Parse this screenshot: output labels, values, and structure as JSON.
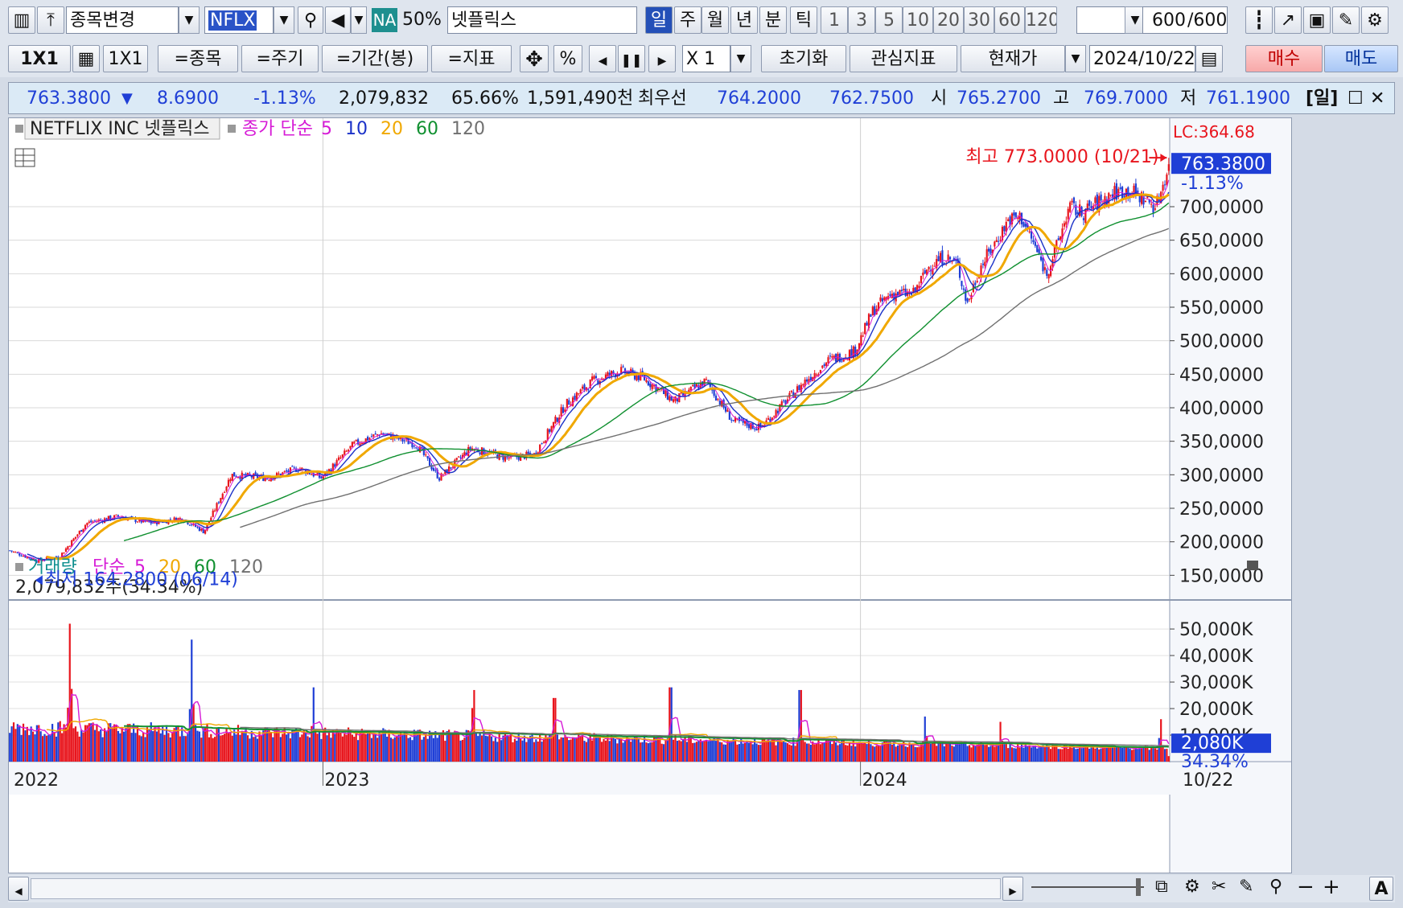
{
  "toolbar1": {
    "stock_change": "종목변경",
    "ticker": "NFLX",
    "na_badge": "NA",
    "percent": "50%",
    "name_kr": "넷플릭스",
    "periods": [
      "일",
      "주",
      "월",
      "년",
      "분",
      "틱"
    ],
    "active_period": "일",
    "nums": [
      "1",
      "3",
      "5",
      "10",
      "20",
      "30",
      "60",
      "120"
    ],
    "count_value": "600",
    "count_total": "/600"
  },
  "toolbar2": {
    "layout": "1X1",
    "layout2": "1X1",
    "stock_btn": "=종목",
    "period_btn": "=주기",
    "range_btn": "=기간(봉)",
    "indicator_btn": "=지표",
    "percent_btn": "%",
    "mult": "X 1",
    "reset": "초기화",
    "fav_indicator": "관심지표",
    "price_type": "현재가",
    "date": "2024/10/22",
    "buy": "매수",
    "sell": "매도"
  },
  "infobar": {
    "price": "763.3800",
    "change": "8.6900",
    "change_pct": "-1.13%",
    "volume": "2,079,832",
    "vol_pct": "65.66%",
    "amount": "1,591,490천",
    "best_label": "최우선",
    "ask": "764.2000",
    "bid": "762.7500",
    "open_label": "시",
    "open": "765.2700",
    "high_label": "고",
    "high": "769.7000",
    "low_label": "저",
    "low": "761.1900",
    "period_tag": "[일]"
  },
  "colors": {
    "up": "#e8151d",
    "down": "#1f3fd6",
    "ma5": "#d61ad6",
    "ma10": "#1a31c8",
    "ma20": "#f0a800",
    "ma60": "#109030",
    "ma120": "#707070",
    "accent": "#0f2fb0"
  },
  "chart_data": [
    {
      "type": "candlestick",
      "title": "NETFLIX INC  넷플릭스",
      "legend": {
        "basis": "종가 단순",
        "periods": [
          "5",
          "10",
          "20",
          "60",
          "120"
        ]
      },
      "x_labels": [
        "2022",
        "2023",
        "2024",
        "10/22"
      ],
      "ylim": [
        130,
        790
      ],
      "y_ticks": [
        "150,0000",
        "200,0000",
        "250,0000",
        "300,0000",
        "350,0000",
        "400,0000",
        "450,0000",
        "500,0000",
        "550,0000",
        "600,0000",
        "650,0000",
        "700,0000"
      ],
      "y_tick_values": [
        150,
        200,
        250,
        300,
        350,
        400,
        450,
        500,
        550,
        600,
        650,
        700
      ],
      "right_label_lc": "LC:364.68",
      "last_price_label": "763.3800",
      "last_change_label": "-1.13%",
      "annotation_high": "최고 773.0000 (10/21)",
      "annotation_low": "최저 164.2800 (06/14)",
      "anchors": [
        {
          "t": 0.0,
          "v": 187
        },
        {
          "t": 0.03,
          "v": 172
        },
        {
          "t": 0.055,
          "v": 178
        },
        {
          "t": 0.085,
          "v": 228
        },
        {
          "t": 0.12,
          "v": 238
        },
        {
          "t": 0.155,
          "v": 228
        },
        {
          "t": 0.19,
          "v": 235
        },
        {
          "t": 0.215,
          "v": 215
        },
        {
          "t": 0.245,
          "v": 300
        },
        {
          "t": 0.285,
          "v": 295
        },
        {
          "t": 0.32,
          "v": 310
        },
        {
          "t": 0.345,
          "v": 295
        },
        {
          "t": 0.38,
          "v": 345
        },
        {
          "t": 0.41,
          "v": 362
        },
        {
          "t": 0.45,
          "v": 345
        },
        {
          "t": 0.475,
          "v": 295
        },
        {
          "t": 0.51,
          "v": 340
        },
        {
          "t": 0.55,
          "v": 325
        },
        {
          "t": 0.58,
          "v": 330
        },
        {
          "t": 0.615,
          "v": 405
        },
        {
          "t": 0.645,
          "v": 440
        },
        {
          "t": 0.675,
          "v": 455
        },
        {
          "t": 0.7,
          "v": 445
        },
        {
          "t": 0.735,
          "v": 410
        },
        {
          "t": 0.77,
          "v": 440
        },
        {
          "t": 0.8,
          "v": 380
        },
        {
          "t": 0.83,
          "v": 370
        },
        {
          "t": 0.855,
          "v": 405
        },
        {
          "t": 0.88,
          "v": 440
        },
        {
          "t": 0.905,
          "v": 470
        },
        {
          "t": 0.935,
          "v": 485
        },
        {
          "t": 0.955,
          "v": 545
        },
        {
          "t": 0.975,
          "v": 570
        }
      ],
      "note": "price anchors span 2022-01 to 2024-05 scaled; continued below",
      "anchors2": [
        {
          "t": 0.0,
          "v": 570
        },
        {
          "t": 0.06,
          "v": 612
        },
        {
          "t": 0.12,
          "v": 625
        },
        {
          "t": 0.17,
          "v": 615
        },
        {
          "t": 0.21,
          "v": 555
        },
        {
          "t": 0.26,
          "v": 610
        },
        {
          "t": 0.31,
          "v": 640
        },
        {
          "t": 0.37,
          "v": 680
        },
        {
          "t": 0.42,
          "v": 685
        },
        {
          "t": 0.47,
          "v": 645
        },
        {
          "t": 0.52,
          "v": 600
        },
        {
          "t": 0.56,
          "v": 640
        },
        {
          "t": 0.61,
          "v": 700
        },
        {
          "t": 0.66,
          "v": 690
        },
        {
          "t": 0.72,
          "v": 705
        },
        {
          "t": 0.78,
          "v": 720
        },
        {
          "t": 0.84,
          "v": 725
        },
        {
          "t": 0.9,
          "v": 712
        },
        {
          "t": 0.95,
          "v": 700
        },
        {
          "t": 1.0,
          "v": 763
        }
      ]
    },
    {
      "type": "bar",
      "title": "거래량",
      "legend": {
        "basis": "단순",
        "periods": [
          "5",
          "20",
          "60",
          "120"
        ]
      },
      "readout": "2,079,832주(34.34%)",
      "y_ticks": [
        "10,000K",
        "20,000K",
        "30,000K",
        "40,000K",
        "50,000K"
      ],
      "y_tick_values": [
        10000,
        20000,
        30000,
        40000,
        50000
      ],
      "ylim": [
        0,
        57000
      ],
      "last_value_label": "2,080K",
      "last_pct_label": "34.34%",
      "baseline_k": 6000,
      "spikes": [
        {
          "t": 0.052,
          "v": 52000
        },
        {
          "t": 0.157,
          "v": 46000
        },
        {
          "t": 0.262,
          "v": 28000
        },
        {
          "t": 0.4,
          "v": 27000
        },
        {
          "t": 0.47,
          "v": 24000
        },
        {
          "t": 0.57,
          "v": 28000
        },
        {
          "t": 0.682,
          "v": 27000
        },
        {
          "t": 0.79,
          "v": 17000
        },
        {
          "t": 0.855,
          "v": 15000
        },
        {
          "t": 0.993,
          "v": 16000
        }
      ]
    }
  ],
  "bottom": {
    "zoom_a": "A"
  }
}
